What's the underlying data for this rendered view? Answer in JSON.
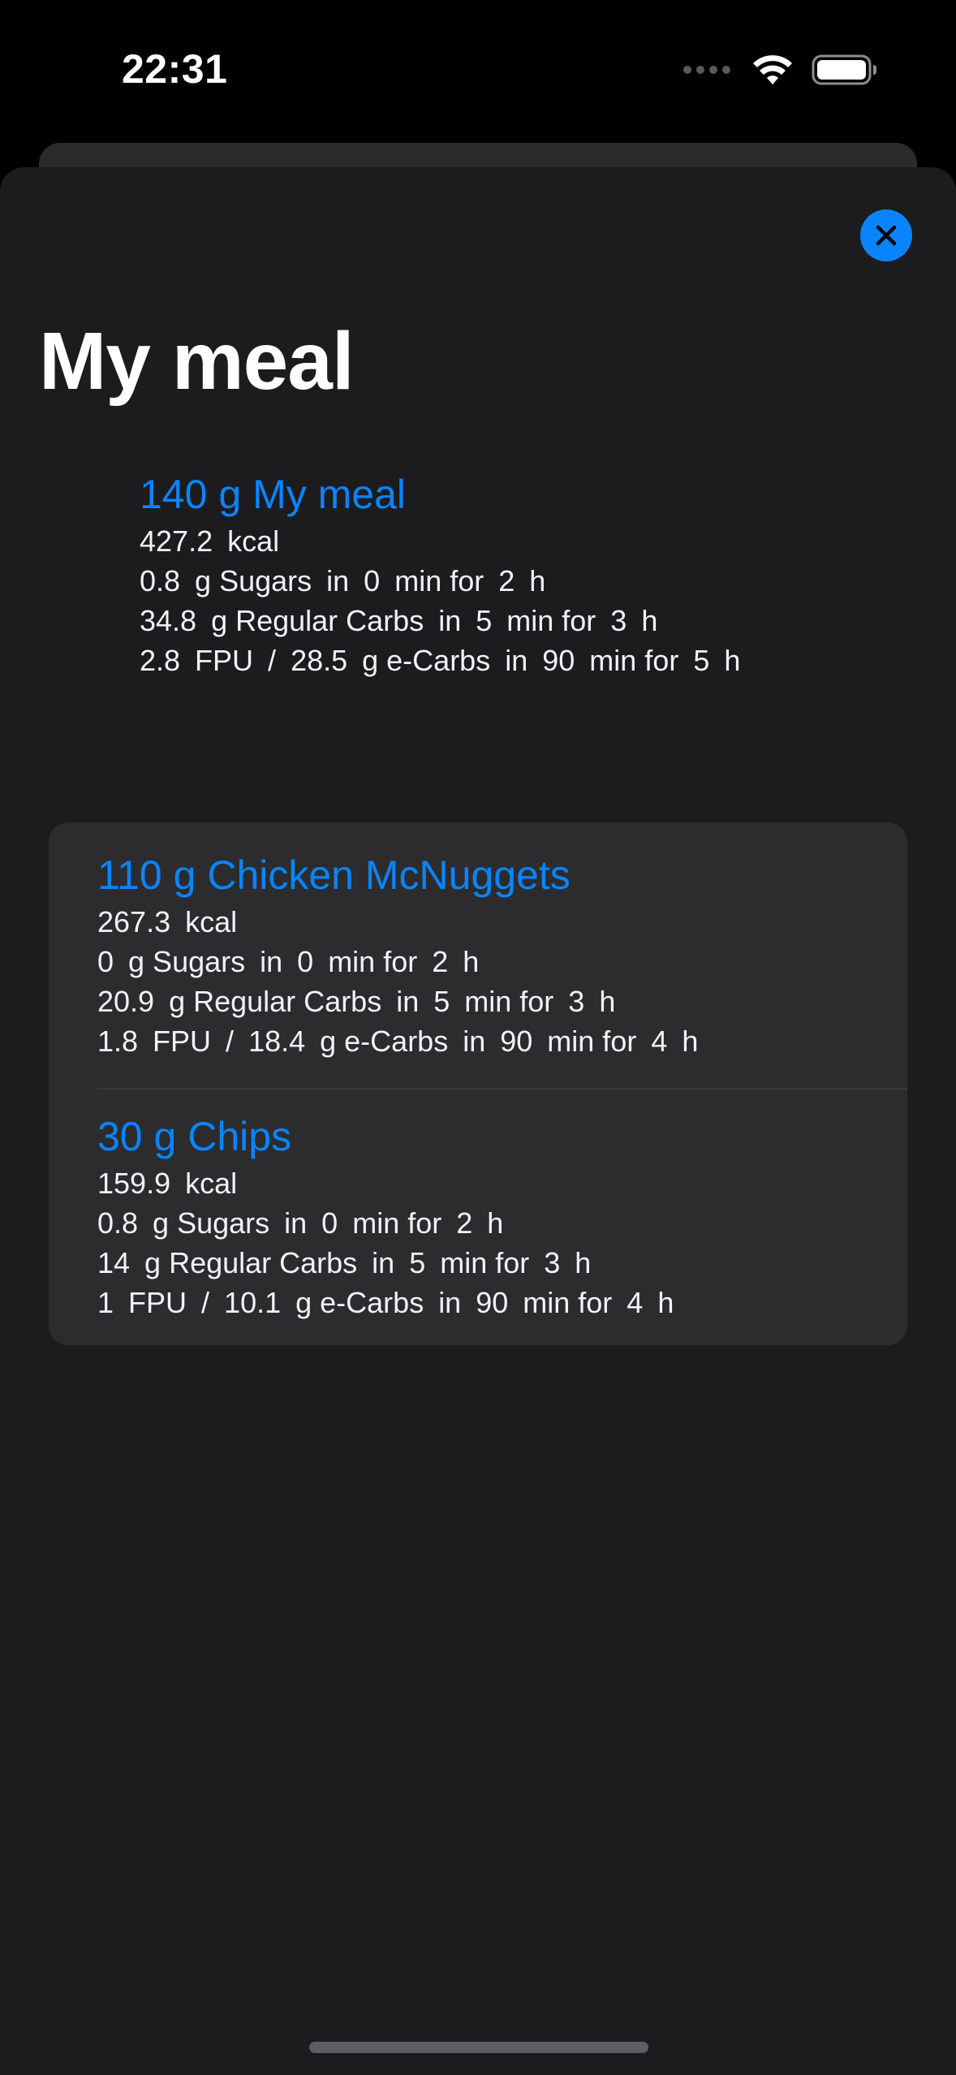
{
  "status_bar": {
    "time": "22:31"
  },
  "header": {
    "title": "My meal",
    "close_icon": "close-icon",
    "accent_color": "#0a84ff"
  },
  "summary": {
    "amount": "140",
    "unit": "g",
    "name": "My meal",
    "kcal": "427.2",
    "kcal_unit": "kcal",
    "sugars": "0.8",
    "sugars_delay": "0",
    "sugars_duration": "2",
    "regular_carbs": "34.8",
    "regular_delay": "5",
    "regular_duration": "3",
    "fpu": "2.8",
    "ecarbs": "28.5",
    "ecarbs_delay": "90",
    "ecarbs_duration": "5"
  },
  "labels": {
    "g": "g",
    "sugars": "g Sugars",
    "regular_carbs": "g Regular Carbs",
    "in": "in",
    "min_for": "min for",
    "h": "h",
    "fpu": "FPU",
    "slash": "/",
    "ecarbs": "g e-Carbs"
  },
  "items": [
    {
      "amount": "110",
      "unit": "g",
      "name": "Chicken McNuggets",
      "kcal": "267.3",
      "kcal_unit": "kcal",
      "sugars": "0",
      "sugars_delay": "0",
      "sugars_duration": "2",
      "regular_carbs": "20.9",
      "regular_delay": "5",
      "regular_duration": "3",
      "fpu": "1.8",
      "ecarbs": "18.4",
      "ecarbs_delay": "90",
      "ecarbs_duration": "4"
    },
    {
      "amount": "30",
      "unit": "g",
      "name": "Chips",
      "kcal": "159.9",
      "kcal_unit": "kcal",
      "sugars": "0.8",
      "sugars_delay": "0",
      "sugars_duration": "2",
      "regular_carbs": "14",
      "regular_delay": "5",
      "regular_duration": "3",
      "fpu": "1",
      "ecarbs": "10.1",
      "ecarbs_delay": "90",
      "ecarbs_duration": "4"
    }
  ]
}
